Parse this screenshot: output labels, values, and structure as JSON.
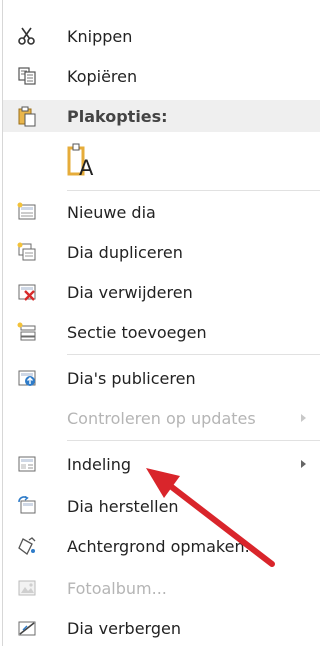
{
  "menu": {
    "cut": {
      "label": "Knippen",
      "icon": "scissors-icon"
    },
    "copy": {
      "label": "Kopiëren",
      "icon": "copy-icon"
    },
    "paste_header": {
      "label": "Plakopties:",
      "icon": "clipboard-icon"
    },
    "paste_option": {
      "glyph": "A",
      "icon": "paste-keep-text-icon"
    },
    "new_slide": {
      "label": "Nieuwe dia",
      "icon": "new-slide-icon"
    },
    "duplicate_slide": {
      "label": "Dia dupliceren",
      "icon": "duplicate-slide-icon"
    },
    "delete_slide": {
      "label": "Dia verwijderen",
      "icon": "delete-slide-icon"
    },
    "add_section": {
      "label": "Sectie toevoegen",
      "icon": "add-section-icon"
    },
    "publish_slides": {
      "label": "Dia's publiceren",
      "icon": "publish-slides-icon"
    },
    "check_updates": {
      "label": "Controleren op updates",
      "disabled": true
    },
    "layout": {
      "label": "Indeling",
      "icon": "layout-icon"
    },
    "reset_slide": {
      "label": "Dia herstellen",
      "icon": "reset-slide-icon"
    },
    "format_background": {
      "label": "Achtergrond opmaken...",
      "icon": "format-background-icon"
    },
    "photo_album": {
      "label": "Fotoalbum...",
      "icon": "photo-album-icon",
      "disabled": true
    },
    "hide_slide": {
      "label": "Dia verbergen",
      "icon": "hide-slide-icon"
    }
  },
  "colors": {
    "annotation_arrow": "#d9252b",
    "disabled_text": "#b5b5b5",
    "header_bg": "#efefef"
  }
}
